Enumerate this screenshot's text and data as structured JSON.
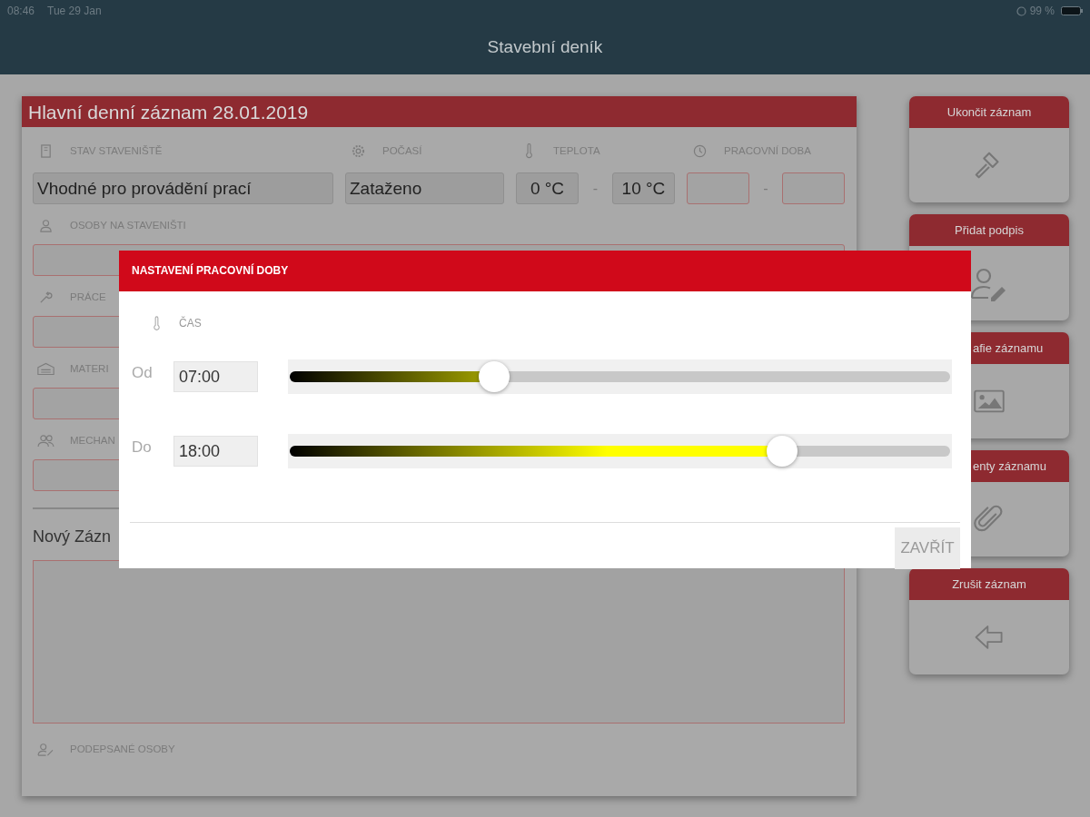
{
  "status_bar": {
    "time": "08:46",
    "date": "Tue 29 Jan",
    "battery": "99 %"
  },
  "app_bar": {
    "title": "Stavební deník"
  },
  "record": {
    "title": "Hlavní denní záznam 28.01.2019",
    "site_status": {
      "label": "STAV STAVENIŠTĚ",
      "value": "Vhodné pro provádění prací"
    },
    "weather": {
      "label": "POČASÍ",
      "value": "Zataženo"
    },
    "temperature": {
      "label": "TEPLOTA",
      "from": "0 °C",
      "separator": "-",
      "to": "10 °C"
    },
    "working_hours": {
      "label": "PRACOVNÍ DOBA",
      "separator": "-"
    },
    "sections": [
      {
        "label": "OSOBY NA STAVENIŠTI"
      },
      {
        "label": "PRÁCE"
      },
      {
        "label": "MATERI"
      },
      {
        "label": "MECHAN"
      }
    ],
    "new_entry": {
      "label": "Nový Zázn"
    },
    "signed_persons": {
      "label": "PODEPSANÉ OSOBY"
    }
  },
  "actions": [
    {
      "label": "Ukončit záznam"
    },
    {
      "label": "Přidat podpis"
    },
    {
      "label": "afie záznamu"
    },
    {
      "label": "enty záznamu"
    },
    {
      "label": "Zrušit záznam"
    }
  ],
  "dialog": {
    "title": "NASTAVENÍ PRACOVNÍ DOBY",
    "section_label": "ČAS",
    "rows": [
      {
        "label": "Od",
        "value": "07:00",
        "level": 0.31
      },
      {
        "label": "Do",
        "value": "18:00",
        "level": 0.745
      }
    ],
    "close_button": "ZAVŘÍT"
  }
}
